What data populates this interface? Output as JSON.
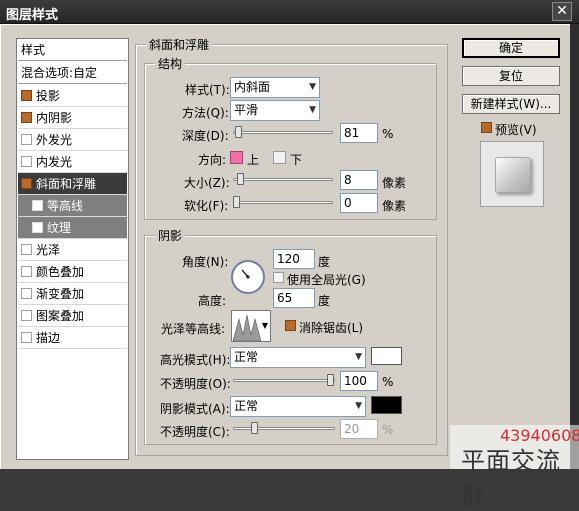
{
  "window": {
    "title": "图层样式",
    "close_icon": "close-icon"
  },
  "style_list": {
    "header": "样式",
    "blending": "混合选项:自定",
    "items": [
      {
        "label": "投影",
        "checked": true
      },
      {
        "label": "内阴影",
        "checked": true
      },
      {
        "label": "外发光",
        "checked": false
      },
      {
        "label": "内发光",
        "checked": false
      },
      {
        "label": "斜面和浮雕",
        "checked": true,
        "selected": true
      },
      {
        "label": "等高线",
        "checked": false,
        "sub": true
      },
      {
        "label": "纹理",
        "checked": false,
        "sub": true
      },
      {
        "label": "光泽",
        "checked": false
      },
      {
        "label": "颜色叠加",
        "checked": false
      },
      {
        "label": "渐变叠加",
        "checked": false
      },
      {
        "label": "图案叠加",
        "checked": false
      },
      {
        "label": "描边",
        "checked": false
      }
    ]
  },
  "bevel": {
    "section_title": "斜面和浮雕",
    "structure": {
      "title": "结构",
      "style_label": "样式(T):",
      "style_value": "内斜面",
      "technique_label": "方法(Q):",
      "technique_value": "平滑",
      "depth_label": "深度(D):",
      "depth_value": "81",
      "depth_unit": "%",
      "direction_label": "方向:",
      "direction_up": "上",
      "direction_down": "下",
      "size_label": "大小(Z):",
      "size_value": "8",
      "size_unit": "像素",
      "soften_label": "软化(F):",
      "soften_value": "0",
      "soften_unit": "像素"
    },
    "shading": {
      "title": "阴影",
      "angle_label": "角度(N):",
      "angle_value": "120",
      "angle_unit": "度",
      "global_light_label": "使用全局光(G)",
      "altitude_label": "高度:",
      "altitude_value": "65",
      "altitude_unit": "度",
      "gloss_contour_label": "光泽等高线:",
      "anti_alias_label": "消除锯齿(L)",
      "highlight_mode_label": "高光模式(H):",
      "highlight_mode_value": "正常",
      "highlight_color": "#ffffff",
      "highlight_opacity_label": "不透明度(O):",
      "highlight_opacity_value": "100",
      "highlight_opacity_unit": "%",
      "shadow_mode_label": "阴影模式(A):",
      "shadow_mode_value": "正常",
      "shadow_color": "#000000",
      "shadow_opacity_label": "不透明度(C):",
      "shadow_opacity_value": "20",
      "shadow_opacity_unit": "%"
    }
  },
  "buttons": {
    "ok": "确定",
    "cancel": "复位",
    "new_style": "新建样式(W)...",
    "preview_label": "预览(V)"
  },
  "watermark": {
    "number": "43940608",
    "text": "平面交流群"
  }
}
